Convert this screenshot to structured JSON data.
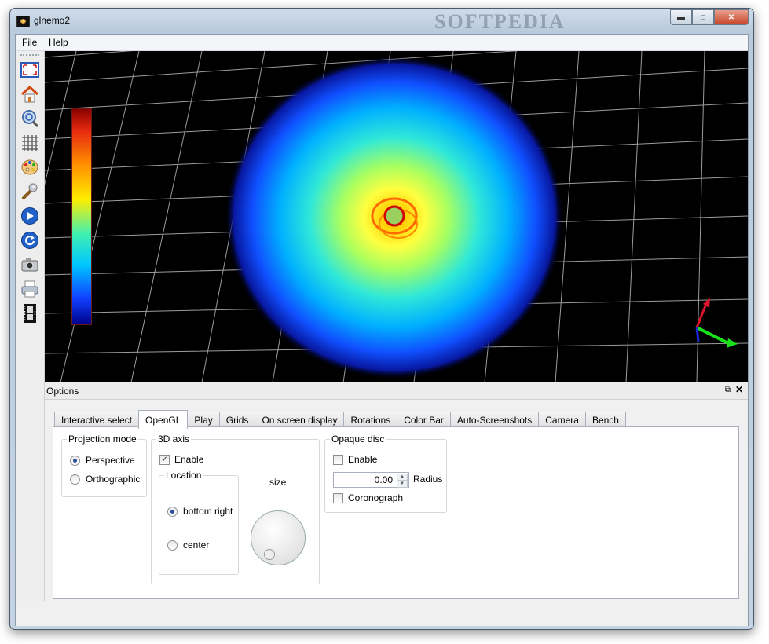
{
  "window": {
    "title": "glnemo2",
    "watermark": "SOFTPEDIA"
  },
  "menu": {
    "file": "File",
    "help": "Help"
  },
  "toolbar": {
    "icons": [
      "fullscreen-icon",
      "home-icon",
      "zoom-icon",
      "grid-icon",
      "palette-icon",
      "wrench-icon",
      "play-icon",
      "reload-icon",
      "camera-icon",
      "printer-icon",
      "film-icon"
    ]
  },
  "options": {
    "title": "Options",
    "float_glyph": "⧉",
    "close_glyph": "✕",
    "tabs": [
      "Interactive select",
      "OpenGL",
      "Play",
      "Grids",
      "On screen display",
      "Rotations",
      "Color Bar",
      "Auto-Screenshots",
      "Camera",
      "Bench"
    ],
    "active_tab": "OpenGL",
    "projection": {
      "title": "Projection mode",
      "perspective": "Perspective",
      "orthographic": "Orthographic",
      "selected": "Perspective"
    },
    "axis": {
      "title": "3D axis",
      "enable": "Enable",
      "enabled": true,
      "location": {
        "title": "Location",
        "bottom_right": "bottom right",
        "center": "center",
        "selected": "bottom right"
      },
      "size_label": "size"
    },
    "disc": {
      "title": "Opaque disc",
      "enable": "Enable",
      "enabled": false,
      "radius_value": "0.00",
      "radius_label": "Radius",
      "coronograph": "Coronograph",
      "coronograph_on": false
    }
  },
  "colors": {
    "grid": "#c8c8c8",
    "axis_x": "#19e01a",
    "axis_y": "#e0142a",
    "axis_z": "#1a2ad8"
  }
}
